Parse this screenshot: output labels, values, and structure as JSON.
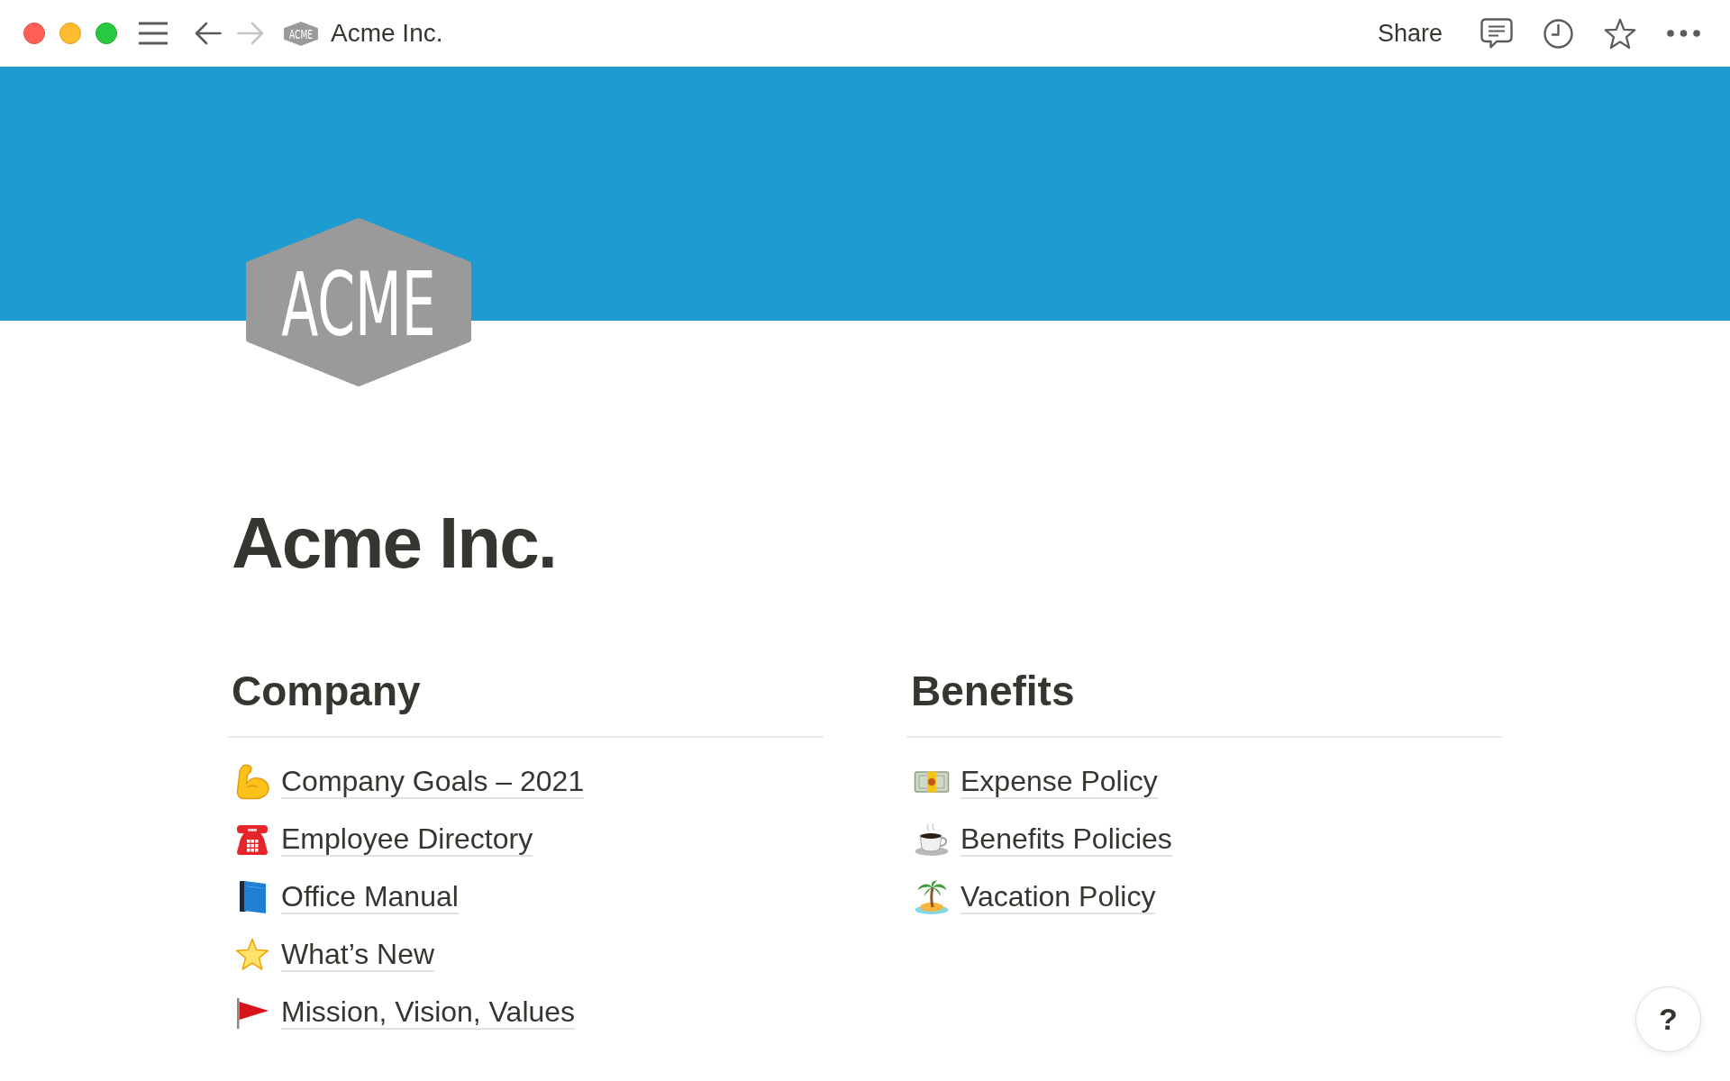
{
  "navigation": {
    "back": {
      "disabled": false
    },
    "forward": {
      "disabled": true
    }
  },
  "breadcrumb": {
    "logo_text": "ACME",
    "title": "Acme Inc."
  },
  "topbar_actions": {
    "share": "Share"
  },
  "page": {
    "logo_text": "ACME",
    "title": "Acme Inc."
  },
  "sections": [
    {
      "heading": "Company",
      "links": [
        {
          "kind": "arm",
          "label": "Company Goals – 2021"
        },
        {
          "kind": "telephone",
          "label": "Employee Directory"
        },
        {
          "kind": "book",
          "label": "Office Manual"
        },
        {
          "kind": "star",
          "label": "What’s New"
        },
        {
          "kind": "flag",
          "label": "Mission, Vision, Values"
        }
      ]
    },
    {
      "heading": "Benefits",
      "links": [
        {
          "kind": "banknote",
          "label": "Expense Policy"
        },
        {
          "kind": "coffee",
          "label": "Benefits Policies"
        },
        {
          "kind": "island",
          "label": "Vacation Policy"
        }
      ]
    }
  ],
  "help": {
    "label": "?"
  }
}
